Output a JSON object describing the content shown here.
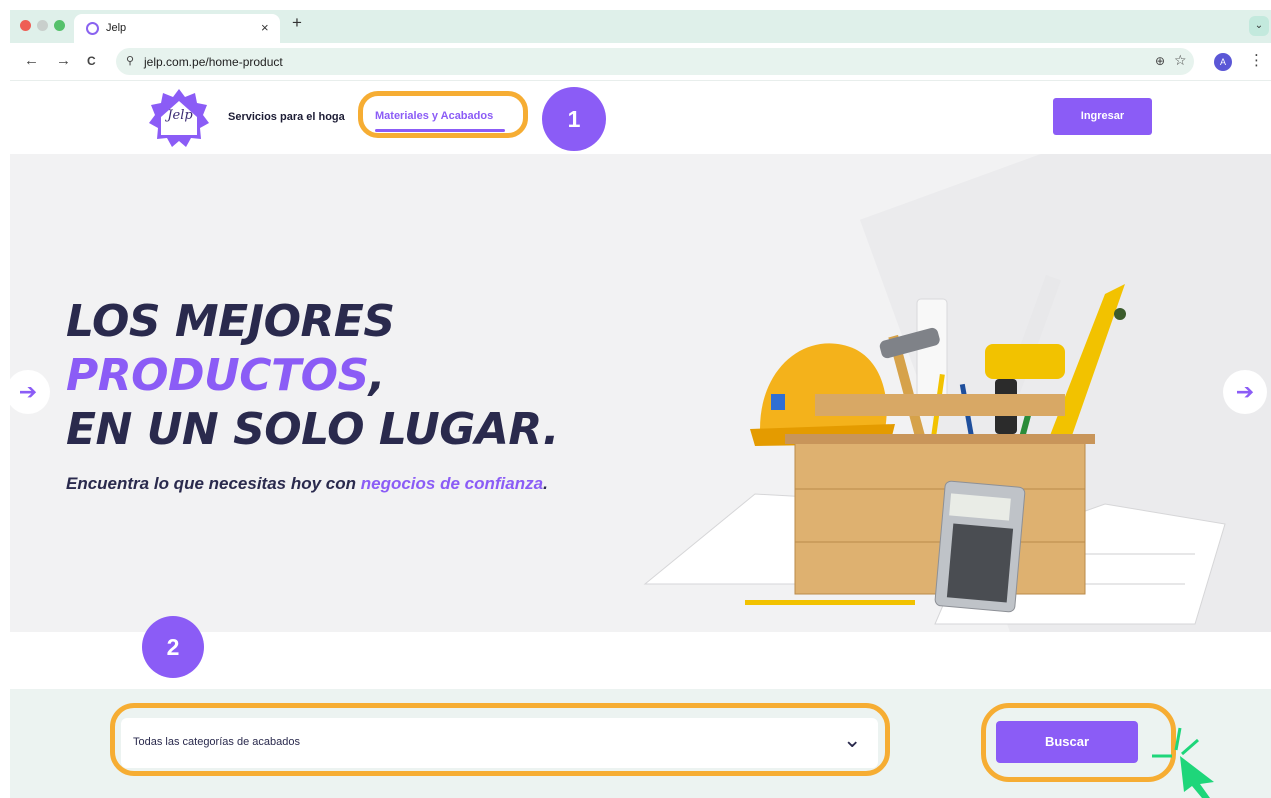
{
  "browser": {
    "tab_title": "Jelp",
    "tab_close": "×",
    "new_tab": "+",
    "tab_menu": "⌄",
    "back": "←",
    "forward": "→",
    "reload": "C",
    "site_info_icon": "⚲",
    "url": "jelp.com.pe/home-product",
    "zoom_icon": "⊕",
    "bookmark_icon": "☆",
    "profile_initial": "A",
    "menu_icon": "⋮"
  },
  "header": {
    "logo_text": "Jelp",
    "nav_services": "Servicios para el hoga",
    "nav_materials": "Materiales y Acabados",
    "login_button": "Ingresar"
  },
  "steps": {
    "step1": "1",
    "step2": "2"
  },
  "hero": {
    "line1": "LOS MEJORES",
    "line2_accent": "PRODUCTOS",
    "line2_rest": ",",
    "line3": "EN UN SOLO LUGAR.",
    "subtitle_start": "Encuentra lo que necesitas hoy con ",
    "subtitle_accent": "negocios de confianza",
    "subtitle_end": ".",
    "prev_arrow": "➔",
    "next_arrow": "➔"
  },
  "search": {
    "category_value": "Todas las categorías de acabados",
    "dropdown_icon": "⌄",
    "button": "Buscar"
  },
  "colors": {
    "brand_purple": "#8b5cf6",
    "highlight_orange": "#f6ad33",
    "headline_navy": "#2a2a4d",
    "cursor_green": "#1ed67a"
  }
}
